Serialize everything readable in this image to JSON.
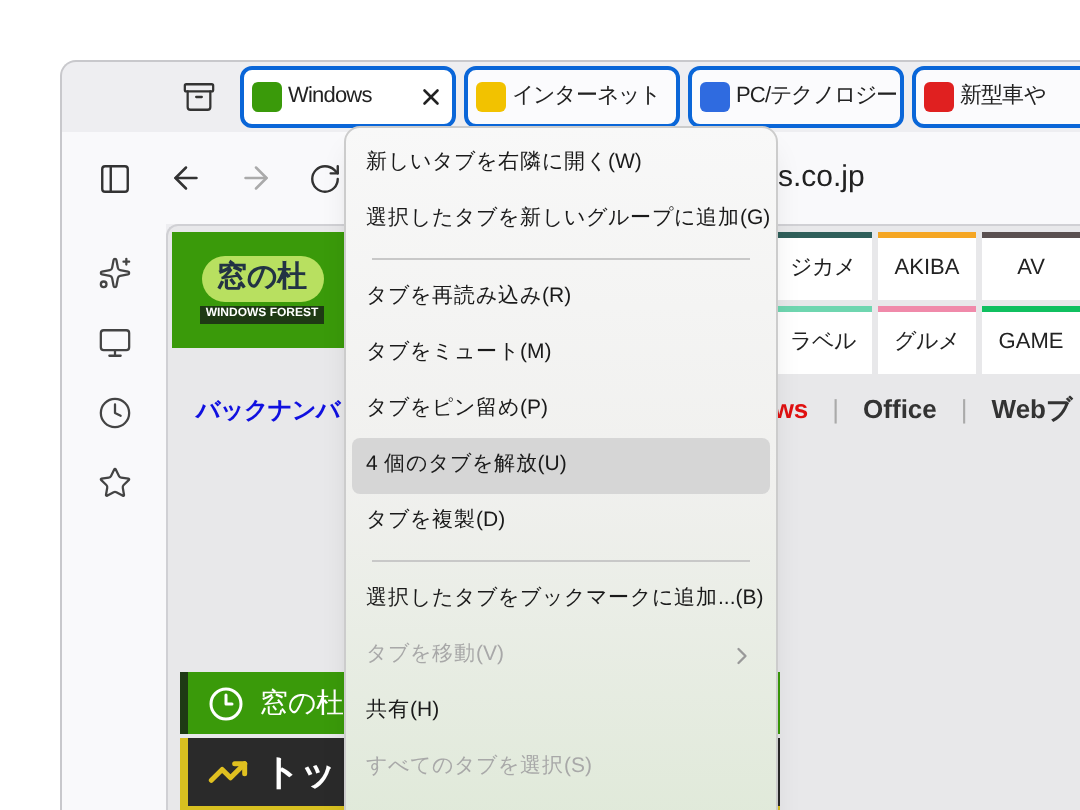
{
  "tabs": [
    {
      "title": "Windows",
      "color": "#3a9a0a",
      "selected": true,
      "active": true
    },
    {
      "title": "インターネット",
      "color": "#f2c200",
      "selected": true,
      "active": false
    },
    {
      "title": "PC/テクノロジー",
      "color": "#2f6be0",
      "selected": true,
      "active": false
    },
    {
      "title": "新型車や",
      "color": "#e02020",
      "selected": true,
      "active": false
    }
  ],
  "address": "s.co.jp",
  "page": {
    "logo": {
      "title": "窓の杜",
      "subtitle": "WINDOWS FOREST"
    },
    "categories": [
      {
        "label": "ジカメ",
        "color": "#2f5f5a"
      },
      {
        "label": "AKIBA",
        "color": "#f5a623"
      },
      {
        "label": "AV",
        "color": "#5a5050"
      },
      {
        "label": "ラベル",
        "color": "#6fd6b0"
      },
      {
        "label": "グルメ",
        "color": "#f08aaa"
      },
      {
        "label": "GAME",
        "color": "#10c060"
      }
    ],
    "backnumber": "バックナンバ",
    "nav": [
      {
        "label": "ws",
        "kind": "highlight"
      },
      {
        "label": "|",
        "kind": "divider"
      },
      {
        "label": "Office",
        "kind": "link"
      },
      {
        "label": "|",
        "kind": "divider"
      },
      {
        "label": "Webブ",
        "kind": "link"
      }
    ],
    "banner": "窓の杜",
    "ranking": "トッ"
  },
  "menu": [
    {
      "kind": "item",
      "label": "新しいタブを右隣に開く(W)",
      "disabled": false,
      "selected": false
    },
    {
      "kind": "item",
      "label": "選択したタブを新しいグループに追加(G)",
      "disabled": false,
      "selected": false
    },
    {
      "kind": "separator"
    },
    {
      "kind": "item",
      "label": "タブを再読み込み(R)",
      "disabled": false,
      "selected": false
    },
    {
      "kind": "item",
      "label": "タブをミュート(M)",
      "disabled": false,
      "selected": false
    },
    {
      "kind": "item",
      "label": "タブをピン留め(P)",
      "disabled": false,
      "selected": false
    },
    {
      "kind": "item",
      "label": "4 個のタブを解放(U)",
      "disabled": false,
      "selected": true
    },
    {
      "kind": "item",
      "label": "タブを複製(D)",
      "disabled": false,
      "selected": false
    },
    {
      "kind": "separator"
    },
    {
      "kind": "item",
      "label": "選択したタブをブックマークに追加...(B)",
      "disabled": false,
      "selected": false
    },
    {
      "kind": "submenu",
      "label": "タブを移動(V)",
      "disabled": true,
      "selected": false
    },
    {
      "kind": "item",
      "label": "共有(H)",
      "disabled": false,
      "selected": false
    },
    {
      "kind": "item",
      "label": "すべてのタブを選択(S)",
      "disabled": true,
      "selected": false
    }
  ]
}
